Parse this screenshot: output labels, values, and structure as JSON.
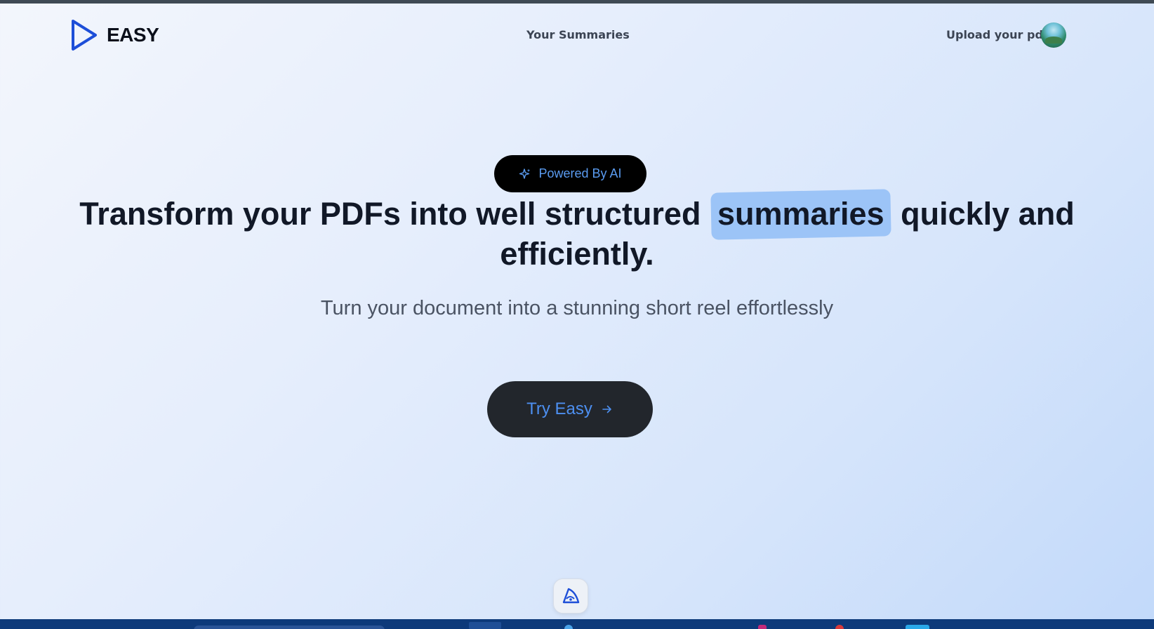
{
  "header": {
    "logo_text": "EASY",
    "nav_link": "Your Summaries",
    "upload_link": "Upload your pdf"
  },
  "hero": {
    "badge_label": "Powered By AI",
    "headline_before": "Transform your PDFs into well structured",
    "headline_highlight": "summaries",
    "headline_after": "quickly and efficiently.",
    "subtitle": "Turn your document into a stunning short reel effortlessly",
    "cta_label": "Try Easy"
  },
  "icons": {
    "logo": "play-triangle-icon",
    "badge": "sparkles-icon",
    "cta": "arrow-right-icon",
    "floating": "pizza-slice-icon",
    "avatar": "user-avatar"
  },
  "colors": {
    "brand_blue": "#1d4ed8",
    "accent_blue": "#5a9bf0",
    "highlight": "#9cc4f7",
    "cta_background": "#22262c",
    "heading": "#111827"
  }
}
